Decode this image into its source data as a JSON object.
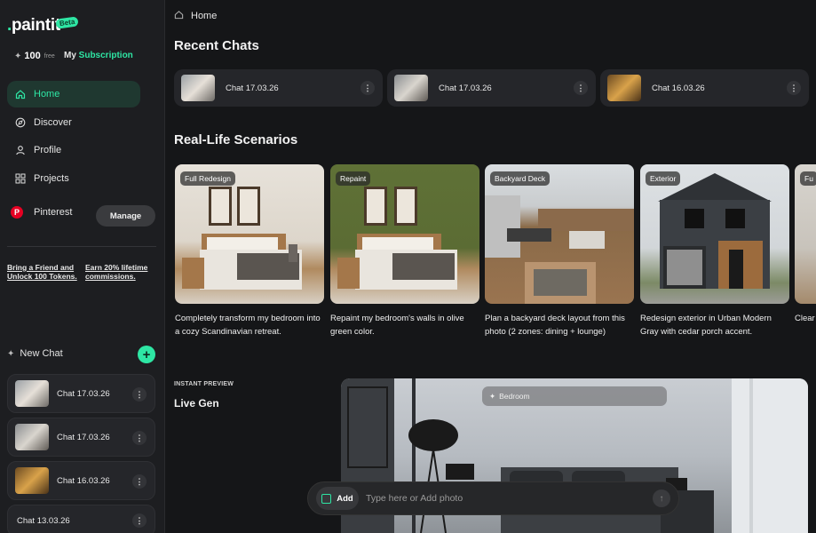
{
  "sidebar": {
    "logo": "paint",
    "logo_tail": "it",
    "beta": "Beta",
    "tokens_count": "100",
    "tokens_free": "free",
    "subscription_prefix": "My ",
    "subscription_link": "Subscription",
    "nav": [
      {
        "label": "Home",
        "icon": "home-icon"
      },
      {
        "label": "Discover",
        "icon": "compass-icon"
      },
      {
        "label": "Profile",
        "icon": "user-icon"
      },
      {
        "label": "Projects",
        "icon": "grid-icon"
      }
    ],
    "pinterest_label": "Pinterest",
    "manage_label": "Manage",
    "promo_friend": "Bring a Friend and Unlock 100 Tokens.",
    "promo_commission": "Earn 20% lifetime commissions.",
    "new_chat_label": "New Chat",
    "new_chat_plus": "+",
    "chats": [
      {
        "label": "Chat 17.03.26"
      },
      {
        "label": "Chat 17.03.26"
      },
      {
        "label": "Chat 16.03.26"
      },
      {
        "label": "Chat 13.03.26"
      }
    ]
  },
  "main": {
    "breadcrumb": "Home",
    "recent_title": "Recent Chats",
    "recent_chats": [
      {
        "label": "Chat 17.03.26"
      },
      {
        "label": "Chat 17.03.26"
      },
      {
        "label": "Chat 16.03.26"
      }
    ],
    "scenarios_title": "Real-Life Scenarios",
    "scenarios": [
      {
        "tag": "Full Redesign",
        "desc": "Completely transform my bedroom into a cozy Scandinavian retreat."
      },
      {
        "tag": "Repaint",
        "desc": "Repaint my bedroom's walls in olive green color."
      },
      {
        "tag": "Backyard Deck",
        "desc": "Plan a backyard deck layout from this photo (2 zones: dining + lounge)"
      },
      {
        "tag": "Exterior",
        "desc": "Redesign exterior in Urban Modern Gray with cedar porch accent."
      },
      {
        "tag": "Fu",
        "desc": "Clear start f"
      }
    ],
    "instant_label": "INSTANT PREVIEW",
    "livegen_title": "Live Gen",
    "bedroom_chip": "Bedroom",
    "add_label": "Add",
    "input_placeholder": "Type here or Add photo"
  },
  "colors": {
    "accent": "#2ee6a4",
    "background": "#151618",
    "sidebar": "#1d1e21",
    "card": "#25262a"
  }
}
